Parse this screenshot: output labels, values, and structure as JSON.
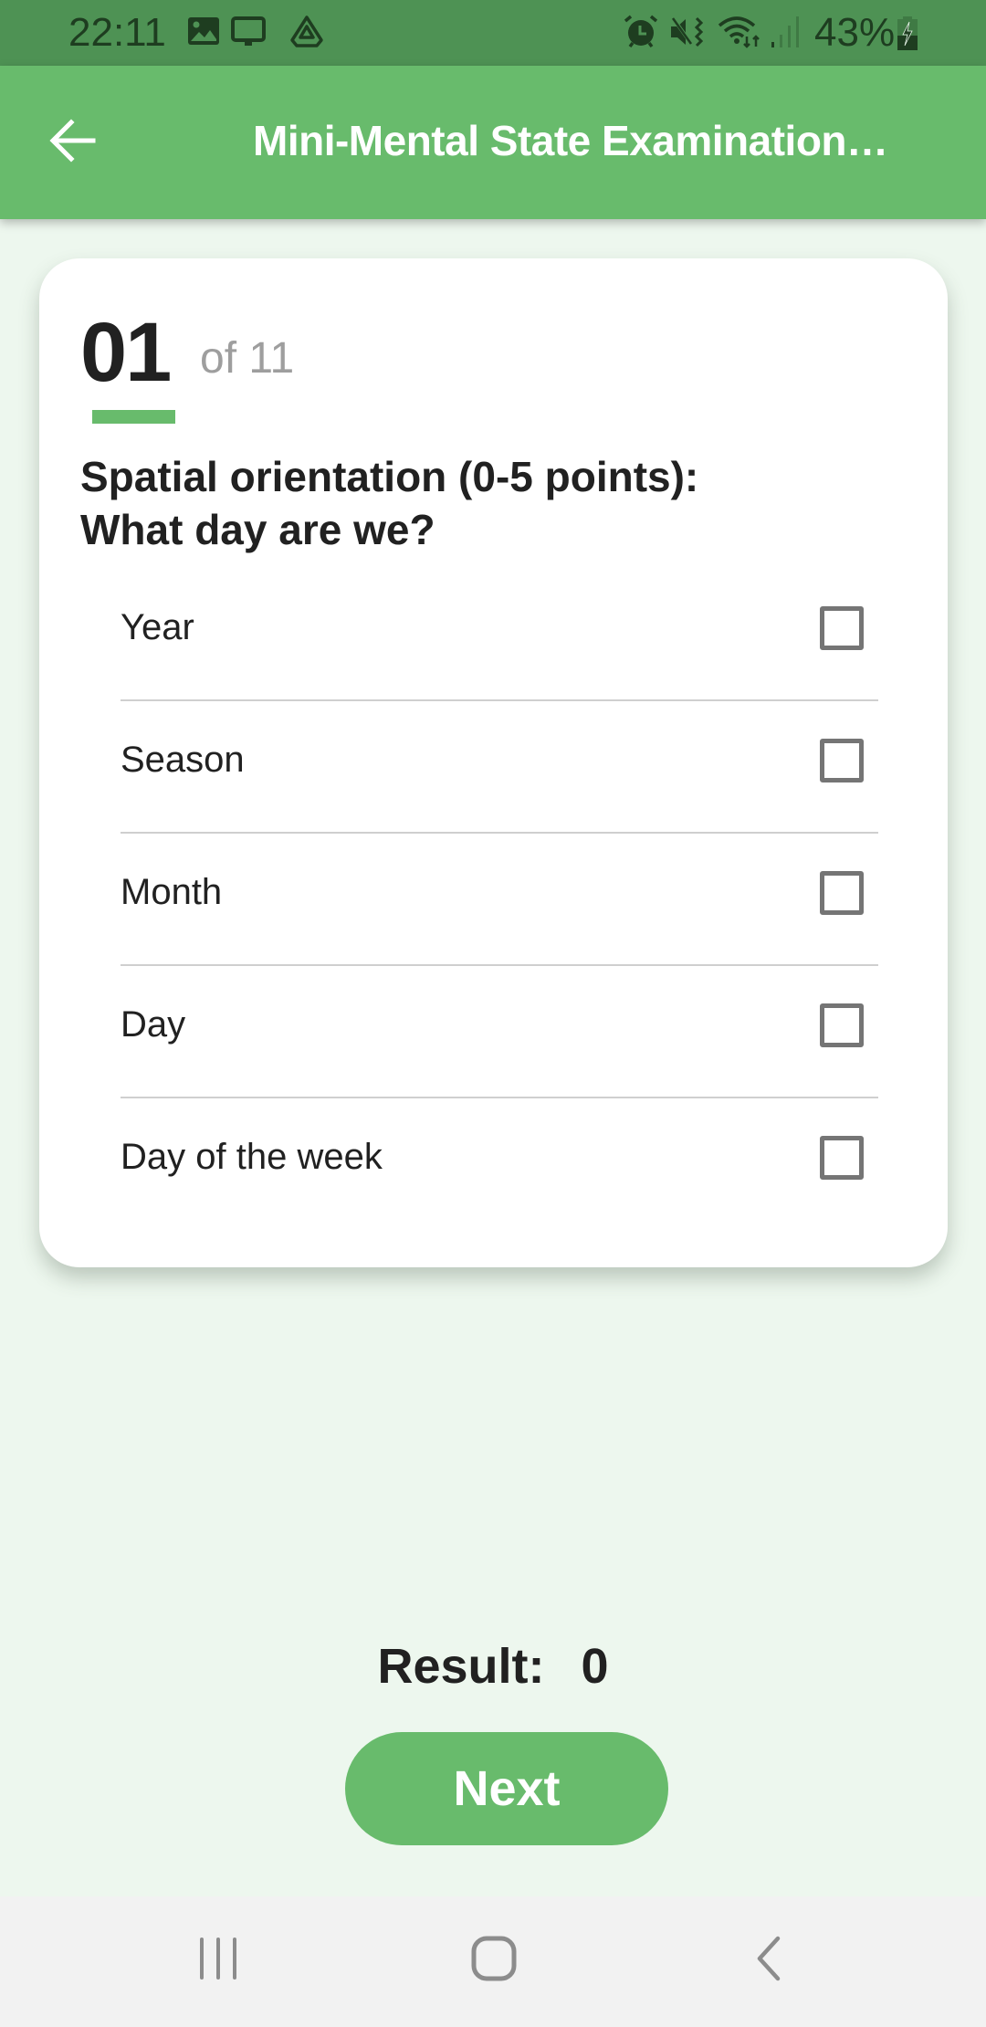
{
  "status_bar": {
    "time": "22:11",
    "left_icons": [
      "gallery-icon",
      "screen-cast-icon",
      "drive-icon"
    ],
    "right_icons": [
      "alarm-icon",
      "vibrate-mute-icon",
      "wifi-icon",
      "signal-icon",
      "battery-charging-icon"
    ],
    "battery": "43%"
  },
  "app_bar": {
    "back_icon": "arrow-left-icon",
    "title": "Mini-Mental State Examination…"
  },
  "question": {
    "number": "01",
    "of_total": "of 11",
    "text_line1": "Spatial orientation (0-5 points):",
    "text_line2": "What day are we?",
    "options": [
      {
        "label": "Year",
        "checked": false
      },
      {
        "label": "Season",
        "checked": false
      },
      {
        "label": "Month",
        "checked": false
      },
      {
        "label": "Day",
        "checked": false
      },
      {
        "label": "Day of the week",
        "checked": false
      }
    ]
  },
  "result": {
    "label": "Result:",
    "value": "0"
  },
  "next_button": {
    "label": "Next"
  },
  "nav_bar": {
    "recents": "recents-icon",
    "home": "home-icon",
    "back": "back-icon"
  },
  "colors": {
    "accent": "#68bb6c",
    "status_bar": "#4e9254",
    "background": "#edf7ee"
  }
}
